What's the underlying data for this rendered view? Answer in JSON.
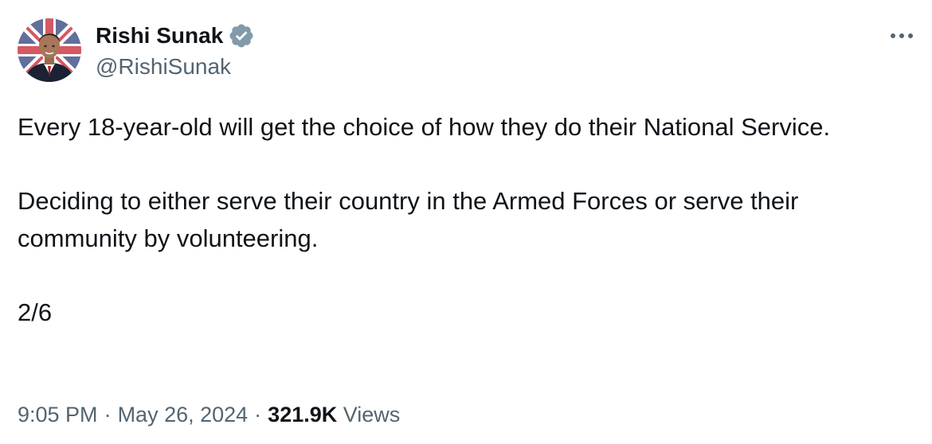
{
  "author": {
    "name": "Rishi Sunak",
    "handle": "@RishiSunak",
    "verified_icon": "verified-badge-icon",
    "verified_color": "#829aab"
  },
  "menu": {
    "more_icon": "more-horizontal-icon"
  },
  "tweet": {
    "paragraphs": [
      "Every 18-year-old will get the choice of how they do their National Service.",
      "Deciding to either serve their country in the Armed Forces or serve their community by volunteering.",
      "2/6"
    ]
  },
  "meta": {
    "time": "9:05 PM",
    "date": "May 26, 2024",
    "views_count": "321.9K",
    "views_label": "Views",
    "separator": "·"
  },
  "colors": {
    "text_primary": "#0f1419",
    "text_secondary": "#536471",
    "background": "#ffffff"
  }
}
